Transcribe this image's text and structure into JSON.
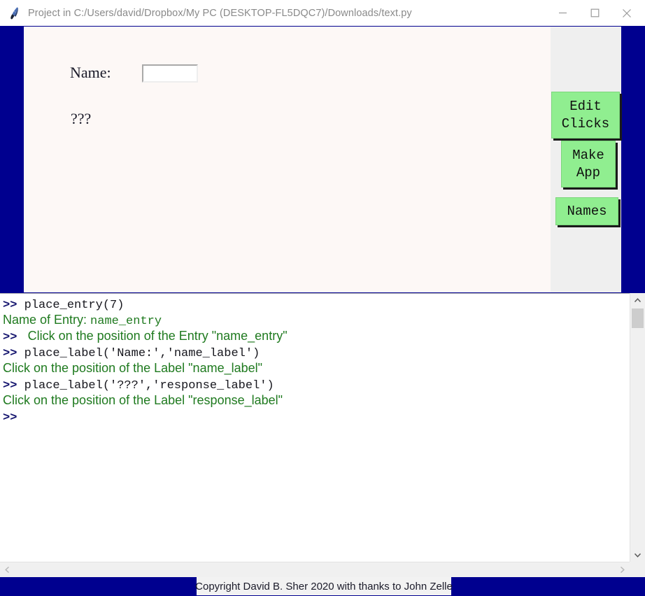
{
  "window": {
    "title": "Project in C:/Users/david/Dropbox/My PC (DESKTOP-FL5DQC7)/Downloads/text.py",
    "icon": "python-feather-icon",
    "controls": {
      "minimize": "minimize-icon",
      "maximize": "maximize-icon",
      "close": "close-icon"
    }
  },
  "colors": {
    "window_background": "#00008f",
    "canvas_background": "#fdf8f6",
    "toolstrip_background": "#efefef",
    "button_green": "#90ee90",
    "prompt_blue": "#14146e",
    "output_green": "#1f7a1f",
    "status_blue": "#00008f"
  },
  "designer": {
    "widgets": [
      {
        "name": "name_label",
        "type": "Label",
        "text": "Name:"
      },
      {
        "name": "name_entry",
        "type": "Entry",
        "value": "",
        "placeholder": ""
      },
      {
        "name": "response_label",
        "type": "Label",
        "text": "???"
      }
    ]
  },
  "toolstrip": {
    "buttons": [
      {
        "name": "edit-clicks",
        "label": "Edit\nClicks"
      },
      {
        "name": "make-app",
        "label": "Make\nApp"
      },
      {
        "name": "names",
        "label": "Names"
      }
    ]
  },
  "console": {
    "lines": [
      {
        "prompt": ">> ",
        "segments": [
          {
            "text": "place_entry(7)",
            "style": "black-mono"
          }
        ]
      },
      {
        "prompt": "",
        "segments": [
          {
            "text": "Name of Entry: ",
            "style": "green-sans"
          },
          {
            "text": "name_entry",
            "style": "green-mono"
          }
        ]
      },
      {
        "prompt": ">> ",
        "segments": [
          {
            "text": " Click on the position of the Entry \"name_entry\"",
            "style": "green-sans"
          }
        ]
      },
      {
        "prompt": ">> ",
        "segments": [
          {
            "text": "place_label('Name:','name_label')",
            "style": "black-mono"
          }
        ]
      },
      {
        "prompt": "",
        "segments": [
          {
            "text": "Click on the position of the Label \"name_label\"",
            "style": "green-sans"
          }
        ]
      },
      {
        "prompt": ">> ",
        "segments": [
          {
            "text": "place_label('???','response_label')",
            "style": "black-mono"
          }
        ]
      },
      {
        "prompt": "",
        "segments": [
          {
            "text": "Click on the position of the Label \"response_label\"",
            "style": "green-sans"
          }
        ]
      },
      {
        "prompt": ">> ",
        "segments": []
      }
    ]
  },
  "scrollbars": {
    "vertical": {
      "up": "chevron-up-icon",
      "down": "chevron-down-icon"
    },
    "horizontal": {
      "left": "chevron-left-icon",
      "right": "chevron-right-icon"
    }
  },
  "status": {
    "copyright": "Copyright David B. Sher 2020 with thanks to John Zelle"
  }
}
